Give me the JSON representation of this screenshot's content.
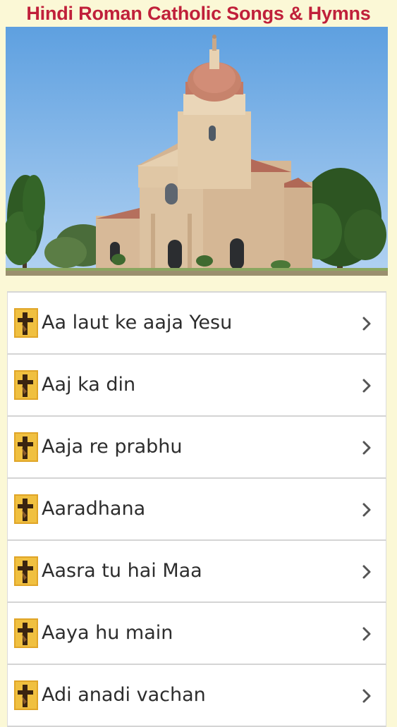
{
  "header": {
    "title": "Hindi Roman Catholic Songs & Hymns"
  },
  "banner": {
    "image": "church-cathedral-photo"
  },
  "songs": [
    {
      "label": "Aa laut ke aaja Yesu"
    },
    {
      "label": "Aaj ka din"
    },
    {
      "label": "Aaja re prabhu"
    },
    {
      "label": "Aaradhana"
    },
    {
      "label": "Aasra tu hai Maa"
    },
    {
      "label": "Aaya hu main"
    },
    {
      "label": "Adi anadi vachan"
    }
  ],
  "icons": {
    "row_icon": "cross-icon",
    "row_arrow": "chevron-right-icon"
  },
  "colors": {
    "title": "#c0203a",
    "background": "#fbf8d6",
    "row_background": "#ffffff",
    "divider": "#d4d4d4",
    "chevron": "#555555"
  }
}
